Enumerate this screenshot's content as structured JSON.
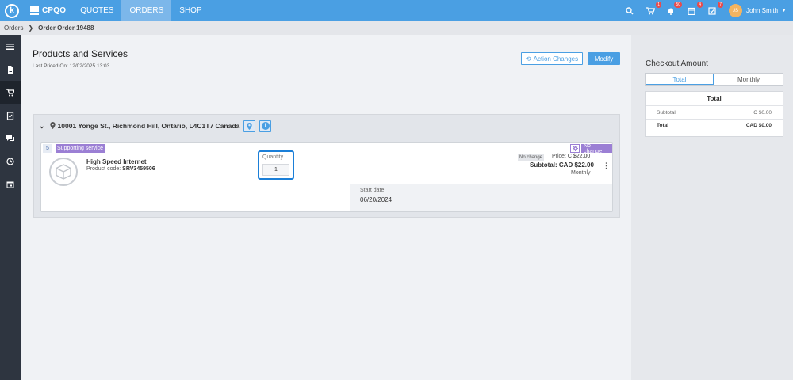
{
  "topbar": {
    "brand": "CPQO",
    "nav": [
      "QUOTES",
      "ORDERS",
      "SHOP"
    ],
    "active_nav": "ORDERS",
    "badges": {
      "cart": "1",
      "bell": "50",
      "orders": "4",
      "tasks": "7"
    },
    "avatar_initials": "JS",
    "username": "John Smith"
  },
  "breadcrumb": {
    "root": "Orders",
    "current": "Order Order 19488"
  },
  "main": {
    "title": "Products and Services",
    "priced_label": "Last Priced On:",
    "priced_value": "12/02/2025 13:03",
    "action_changes": "Action Changes",
    "modify": "Modify"
  },
  "location": {
    "address": "10001 Yonge St., Richmond Hill, Ontario, L4C1T7 Canada"
  },
  "item": {
    "count": "5",
    "type": "Supporting service",
    "name": "High Speed Internet",
    "code_label": "Product code:",
    "code_value": "SRV3459506",
    "quantity_label": "Quantity",
    "quantity_value": "1",
    "status_chip": "No change",
    "price_status": "No change",
    "price_label": "Price:",
    "price_value": "C $22.00",
    "subtotal_label": "Subtotal:",
    "subtotal_value": "CAD $22.00",
    "frequency": "Monthly",
    "start_label": "Start date:",
    "start_value": "06/20/2024"
  },
  "checkout": {
    "title": "Checkout Amount",
    "tabs": [
      "Total",
      "Monthly"
    ],
    "active_tab": "Total",
    "card_title": "Total",
    "subtotal_label": "Subtotal",
    "subtotal_value": "C $0.00",
    "total_label": "Total",
    "total_value": "CAD $0.00"
  },
  "colors": {
    "accent": "#4a9fe3",
    "chip": "#9b7fd4",
    "sidebar": "#2e3540"
  }
}
